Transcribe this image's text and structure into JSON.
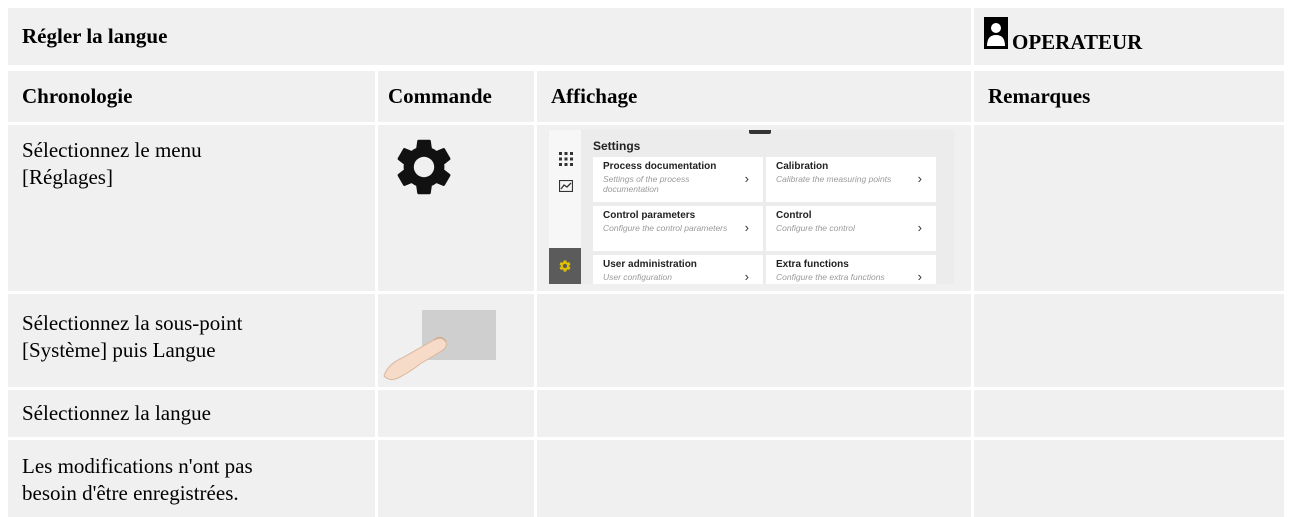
{
  "header": {
    "title": "Régler la langue",
    "role_label": "OPERATEUR"
  },
  "columns": {
    "chronology": "Chronologie",
    "command": "Commande",
    "display": "Affichage",
    "remarks": "Remarques"
  },
  "rows": [
    {
      "step": "Sélectionnez le menu [Réglages]",
      "command_icon": "gear-icon"
    },
    {
      "step": "Sélectionnez la sous-point [Système] puis Langue",
      "command_icon": "finger-touch-icon"
    },
    {
      "step": "Sélectionnez la langue"
    },
    {
      "step": "Les modifications n'ont pas besoin d'être enregistrées."
    }
  ],
  "settings_screen": {
    "title": "Settings",
    "tiles": [
      {
        "title": "Process documentation",
        "subtitle": "Settings of the process documentation"
      },
      {
        "title": "Calibration",
        "subtitle": "Calibrate the measuring points"
      },
      {
        "title": "Control parameters",
        "subtitle": "Configure the control parameters"
      },
      {
        "title": "Control",
        "subtitle": "Configure the control"
      },
      {
        "title": "User administration",
        "subtitle": "User configuration"
      },
      {
        "title": "Extra functions",
        "subtitle": "Configure the extra functions"
      }
    ]
  },
  "colors": {
    "cell_bg": "#f0f0f0",
    "active_rail": "#5b5b5b",
    "gear_yellow": "#e0c000"
  }
}
